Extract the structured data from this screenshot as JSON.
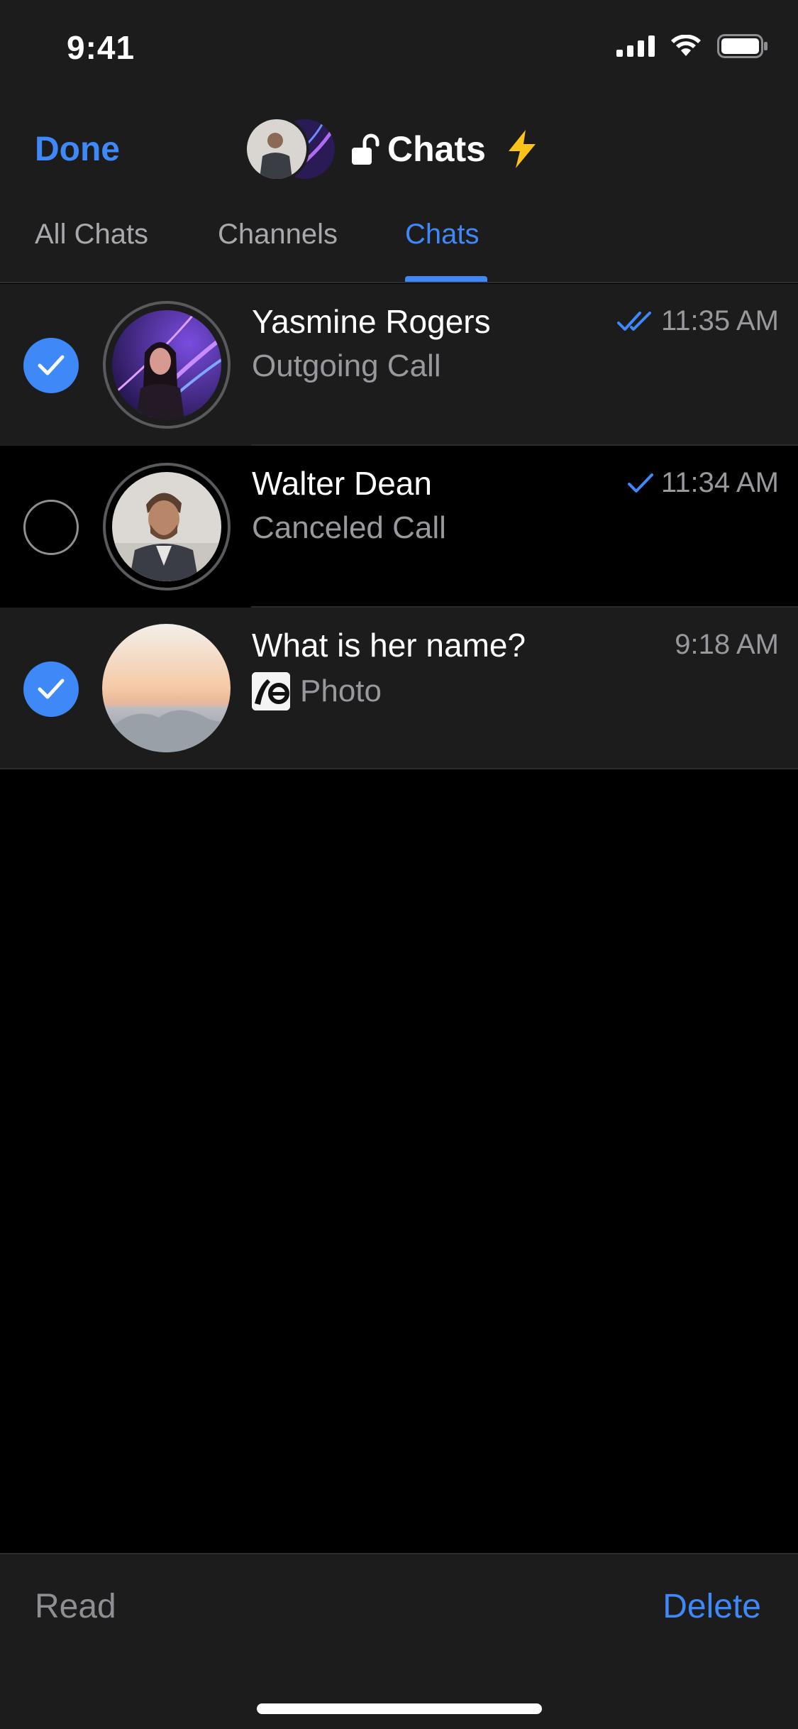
{
  "status": {
    "time": "9:41"
  },
  "header": {
    "done_label": "Done",
    "title": "Chats",
    "lock_icon": "lock-open-icon",
    "bolt_icon": "lightning-bolt-icon"
  },
  "tabs": [
    {
      "label": "All Chats",
      "active": false
    },
    {
      "label": "Channels",
      "active": false
    },
    {
      "label": "Chats",
      "active": true
    }
  ],
  "chats": [
    {
      "name": "Yasmine Rogers",
      "message": "Outgoing Call",
      "time": "11:35 AM",
      "status": "read-double-check",
      "selected": true
    },
    {
      "name": "Walter Dean",
      "message": "Canceled Call",
      "time": "11:34 AM",
      "status": "sent-single-check",
      "selected": false
    },
    {
      "name": "What is her name?",
      "message": "Photo",
      "time": "9:18 AM",
      "status": "none",
      "selected": true
    }
  ],
  "toolbar": {
    "read_label": "Read",
    "delete_label": "Delete"
  },
  "colors": {
    "accent": "#3e88f7",
    "background": "#000000",
    "surface": "#1c1c1d",
    "secondary_text": "#98989d"
  }
}
